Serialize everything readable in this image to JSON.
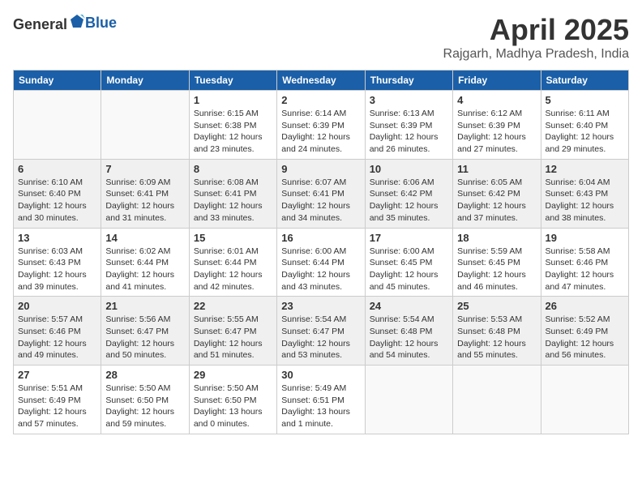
{
  "logo": {
    "text_general": "General",
    "text_blue": "Blue"
  },
  "header": {
    "month": "April 2025",
    "location": "Rajgarh, Madhya Pradesh, India"
  },
  "weekdays": [
    "Sunday",
    "Monday",
    "Tuesday",
    "Wednesday",
    "Thursday",
    "Friday",
    "Saturday"
  ],
  "weeks": [
    [
      {
        "day": "",
        "sunrise": "",
        "sunset": "",
        "daylight": ""
      },
      {
        "day": "",
        "sunrise": "",
        "sunset": "",
        "daylight": ""
      },
      {
        "day": "1",
        "sunrise": "Sunrise: 6:15 AM",
        "sunset": "Sunset: 6:38 PM",
        "daylight": "Daylight: 12 hours and 23 minutes."
      },
      {
        "day": "2",
        "sunrise": "Sunrise: 6:14 AM",
        "sunset": "Sunset: 6:39 PM",
        "daylight": "Daylight: 12 hours and 24 minutes."
      },
      {
        "day": "3",
        "sunrise": "Sunrise: 6:13 AM",
        "sunset": "Sunset: 6:39 PM",
        "daylight": "Daylight: 12 hours and 26 minutes."
      },
      {
        "day": "4",
        "sunrise": "Sunrise: 6:12 AM",
        "sunset": "Sunset: 6:39 PM",
        "daylight": "Daylight: 12 hours and 27 minutes."
      },
      {
        "day": "5",
        "sunrise": "Sunrise: 6:11 AM",
        "sunset": "Sunset: 6:40 PM",
        "daylight": "Daylight: 12 hours and 29 minutes."
      }
    ],
    [
      {
        "day": "6",
        "sunrise": "Sunrise: 6:10 AM",
        "sunset": "Sunset: 6:40 PM",
        "daylight": "Daylight: 12 hours and 30 minutes."
      },
      {
        "day": "7",
        "sunrise": "Sunrise: 6:09 AM",
        "sunset": "Sunset: 6:41 PM",
        "daylight": "Daylight: 12 hours and 31 minutes."
      },
      {
        "day": "8",
        "sunrise": "Sunrise: 6:08 AM",
        "sunset": "Sunset: 6:41 PM",
        "daylight": "Daylight: 12 hours and 33 minutes."
      },
      {
        "day": "9",
        "sunrise": "Sunrise: 6:07 AM",
        "sunset": "Sunset: 6:41 PM",
        "daylight": "Daylight: 12 hours and 34 minutes."
      },
      {
        "day": "10",
        "sunrise": "Sunrise: 6:06 AM",
        "sunset": "Sunset: 6:42 PM",
        "daylight": "Daylight: 12 hours and 35 minutes."
      },
      {
        "day": "11",
        "sunrise": "Sunrise: 6:05 AM",
        "sunset": "Sunset: 6:42 PM",
        "daylight": "Daylight: 12 hours and 37 minutes."
      },
      {
        "day": "12",
        "sunrise": "Sunrise: 6:04 AM",
        "sunset": "Sunset: 6:43 PM",
        "daylight": "Daylight: 12 hours and 38 minutes."
      }
    ],
    [
      {
        "day": "13",
        "sunrise": "Sunrise: 6:03 AM",
        "sunset": "Sunset: 6:43 PM",
        "daylight": "Daylight: 12 hours and 39 minutes."
      },
      {
        "day": "14",
        "sunrise": "Sunrise: 6:02 AM",
        "sunset": "Sunset: 6:44 PM",
        "daylight": "Daylight: 12 hours and 41 minutes."
      },
      {
        "day": "15",
        "sunrise": "Sunrise: 6:01 AM",
        "sunset": "Sunset: 6:44 PM",
        "daylight": "Daylight: 12 hours and 42 minutes."
      },
      {
        "day": "16",
        "sunrise": "Sunrise: 6:00 AM",
        "sunset": "Sunset: 6:44 PM",
        "daylight": "Daylight: 12 hours and 43 minutes."
      },
      {
        "day": "17",
        "sunrise": "Sunrise: 6:00 AM",
        "sunset": "Sunset: 6:45 PM",
        "daylight": "Daylight: 12 hours and 45 minutes."
      },
      {
        "day": "18",
        "sunrise": "Sunrise: 5:59 AM",
        "sunset": "Sunset: 6:45 PM",
        "daylight": "Daylight: 12 hours and 46 minutes."
      },
      {
        "day": "19",
        "sunrise": "Sunrise: 5:58 AM",
        "sunset": "Sunset: 6:46 PM",
        "daylight": "Daylight: 12 hours and 47 minutes."
      }
    ],
    [
      {
        "day": "20",
        "sunrise": "Sunrise: 5:57 AM",
        "sunset": "Sunset: 6:46 PM",
        "daylight": "Daylight: 12 hours and 49 minutes."
      },
      {
        "day": "21",
        "sunrise": "Sunrise: 5:56 AM",
        "sunset": "Sunset: 6:47 PM",
        "daylight": "Daylight: 12 hours and 50 minutes."
      },
      {
        "day": "22",
        "sunrise": "Sunrise: 5:55 AM",
        "sunset": "Sunset: 6:47 PM",
        "daylight": "Daylight: 12 hours and 51 minutes."
      },
      {
        "day": "23",
        "sunrise": "Sunrise: 5:54 AM",
        "sunset": "Sunset: 6:47 PM",
        "daylight": "Daylight: 12 hours and 53 minutes."
      },
      {
        "day": "24",
        "sunrise": "Sunrise: 5:54 AM",
        "sunset": "Sunset: 6:48 PM",
        "daylight": "Daylight: 12 hours and 54 minutes."
      },
      {
        "day": "25",
        "sunrise": "Sunrise: 5:53 AM",
        "sunset": "Sunset: 6:48 PM",
        "daylight": "Daylight: 12 hours and 55 minutes."
      },
      {
        "day": "26",
        "sunrise": "Sunrise: 5:52 AM",
        "sunset": "Sunset: 6:49 PM",
        "daylight": "Daylight: 12 hours and 56 minutes."
      }
    ],
    [
      {
        "day": "27",
        "sunrise": "Sunrise: 5:51 AM",
        "sunset": "Sunset: 6:49 PM",
        "daylight": "Daylight: 12 hours and 57 minutes."
      },
      {
        "day": "28",
        "sunrise": "Sunrise: 5:50 AM",
        "sunset": "Sunset: 6:50 PM",
        "daylight": "Daylight: 12 hours and 59 minutes."
      },
      {
        "day": "29",
        "sunrise": "Sunrise: 5:50 AM",
        "sunset": "Sunset: 6:50 PM",
        "daylight": "Daylight: 13 hours and 0 minutes."
      },
      {
        "day": "30",
        "sunrise": "Sunrise: 5:49 AM",
        "sunset": "Sunset: 6:51 PM",
        "daylight": "Daylight: 13 hours and 1 minute."
      },
      {
        "day": "",
        "sunrise": "",
        "sunset": "",
        "daylight": ""
      },
      {
        "day": "",
        "sunrise": "",
        "sunset": "",
        "daylight": ""
      },
      {
        "day": "",
        "sunrise": "",
        "sunset": "",
        "daylight": ""
      }
    ]
  ]
}
